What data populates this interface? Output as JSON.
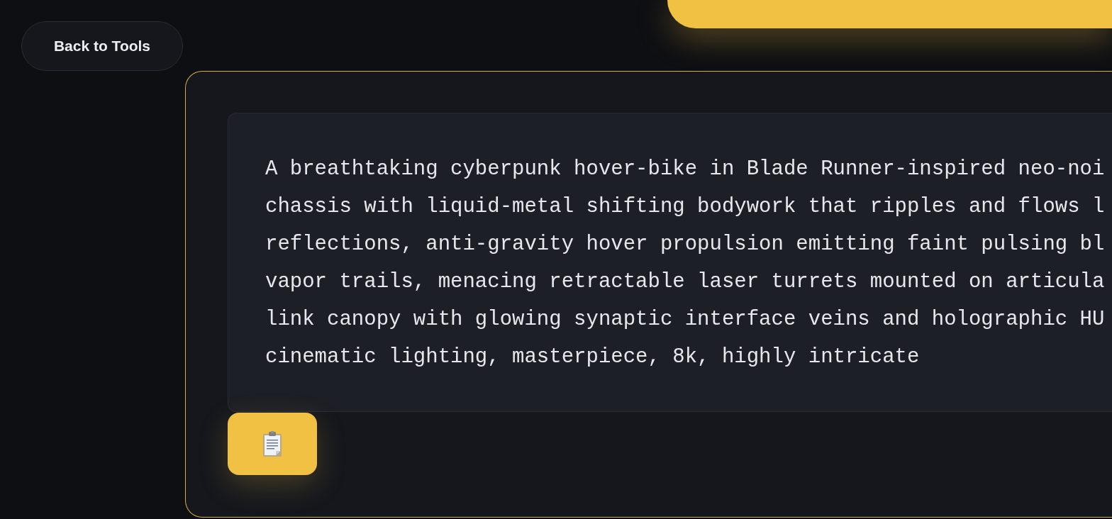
{
  "back_button": {
    "label": "Back to Tools"
  },
  "prompt_card": {
    "prompt_lines": [
      "A breathtaking cyberpunk hover-bike in Blade Runner-inspired neo-noi",
      "chassis with liquid-metal shifting bodywork that ripples and flows l",
      "reflections, anti-gravity hover propulsion emitting faint pulsing bl",
      "vapor trails, menacing retractable laser turrets mounted on articula",
      "link canopy with glowing synaptic interface veins and holographic HU",
      "cinematic lighting, masterpiece, 8k, highly intricate"
    ]
  }
}
